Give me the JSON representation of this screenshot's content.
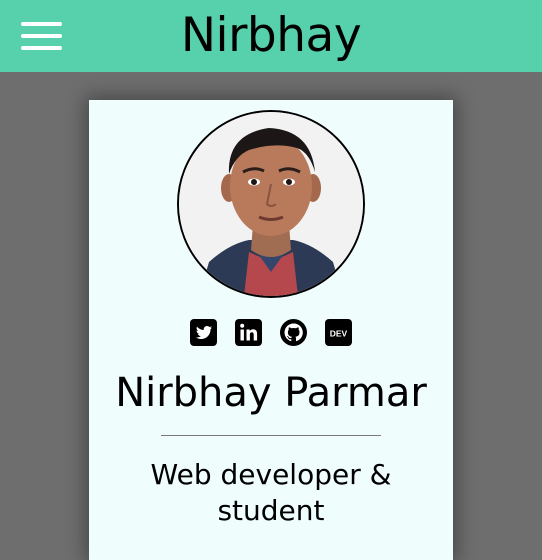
{
  "header": {
    "title": "Nirbhay",
    "menu_icon": "hamburger-menu-icon",
    "background_color": "#57d1ab"
  },
  "profile": {
    "name": "Nirbhay Parmar",
    "tagline": "Web developer & student",
    "avatar": "profile-photo",
    "card_color": "#effdfd"
  },
  "social_links": [
    {
      "icon": "twitter-icon"
    },
    {
      "icon": "linkedin-icon"
    },
    {
      "icon": "github-icon"
    },
    {
      "icon": "dev-to-icon"
    }
  ],
  "page": {
    "background_color": "#6e6e6e"
  }
}
